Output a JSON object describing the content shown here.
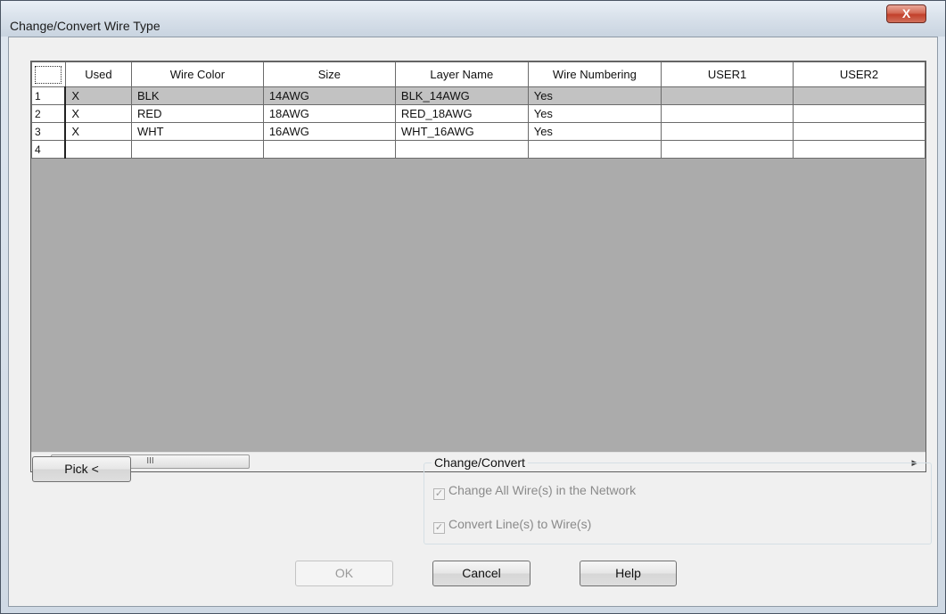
{
  "window": {
    "title": "Change/Convert Wire Type",
    "close_label": "X"
  },
  "grid": {
    "columns": [
      "Used",
      "Wire Color",
      "Size",
      "Layer Name",
      "Wire Numbering",
      "USER1",
      "USER2"
    ],
    "rows": [
      {
        "num": "1",
        "used": "X",
        "color": "BLK",
        "size": "14AWG",
        "layer": "BLK_14AWG",
        "numbering": "Yes",
        "user1": "",
        "user2": ""
      },
      {
        "num": "2",
        "used": "X",
        "color": "RED",
        "size": "18AWG",
        "layer": "RED_18AWG",
        "numbering": "Yes",
        "user1": "",
        "user2": ""
      },
      {
        "num": "3",
        "used": "X",
        "color": "WHT",
        "size": "16AWG",
        "layer": "WHT_16AWG",
        "numbering": "Yes",
        "user1": "",
        "user2": ""
      },
      {
        "num": "4",
        "used": "",
        "color": "",
        "size": "",
        "layer": "",
        "numbering": "",
        "user1": "",
        "user2": ""
      }
    ],
    "selected_row": 1,
    "scroll_thumb_grip": "III"
  },
  "pick_button": "Pick <",
  "change_convert": {
    "group_label": "Change/Convert",
    "options": [
      {
        "label": "Change All Wire(s) in the Network",
        "checked": true,
        "enabled": false
      },
      {
        "label": "Convert Line(s) to Wire(s)",
        "checked": true,
        "enabled": false
      }
    ]
  },
  "buttons": {
    "ok": "OK",
    "cancel": "Cancel",
    "help": "Help"
  },
  "colors": {
    "close_button": "#c2402b",
    "selected_row": "#c2c2c2",
    "disabled_text": "#9a9a9a"
  }
}
